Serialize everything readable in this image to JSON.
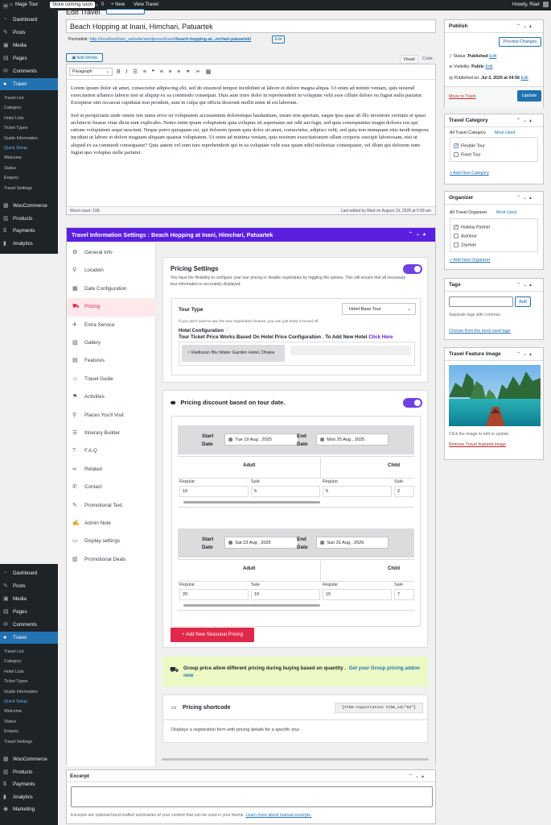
{
  "adminbar": {
    "site": "Mage Tour",
    "badge": "Store coming soon",
    "comments": "0",
    "new": "New",
    "view": "View Travel",
    "howdy": "Howdy, Riad"
  },
  "menu_top": [
    {
      "icon": "◔",
      "label": "Dashboard"
    },
    {
      "icon": "✎",
      "label": "Posts"
    },
    {
      "icon": "▣",
      "label": "Media"
    },
    {
      "icon": "▤",
      "label": "Pages"
    },
    {
      "icon": "✉",
      "label": "Comments"
    },
    {
      "icon": "●",
      "label": "Travel",
      "current": true
    }
  ],
  "submenu": [
    "Travel List",
    "Category",
    "Hotel Lists",
    "Ticket Types",
    "Guide Information",
    "Quick Setup",
    "Welcome",
    "Status",
    "Enquiry",
    "Travel Settings"
  ],
  "menu_bottom": [
    {
      "icon": "▦",
      "label": "WooCommerce"
    },
    {
      "icon": "▥",
      "label": "Products"
    },
    {
      "icon": "$",
      "label": "Payments"
    },
    {
      "icon": "▮",
      "label": "Analytics"
    }
  ],
  "menu_top2": [
    {
      "icon": "◔",
      "label": "Dashboard"
    },
    {
      "icon": "✎",
      "label": "Posts"
    },
    {
      "icon": "▣",
      "label": "Media"
    },
    {
      "icon": "▤",
      "label": "Pages"
    },
    {
      "icon": "✉",
      "label": "Comments"
    },
    {
      "icon": "●",
      "label": "Travel",
      "current": true
    }
  ],
  "menu_bottom2": [
    {
      "icon": "▦",
      "label": "WooCommerce"
    },
    {
      "icon": "▥",
      "label": "Products"
    },
    {
      "icon": "$",
      "label": "Payments"
    },
    {
      "icon": "▮",
      "label": "Analytics"
    },
    {
      "icon": "◉",
      "label": "Marketing"
    }
  ],
  "post": {
    "title": "Beach Hopping at Inani, Himchari, Patuartek",
    "permalink_label": "Permalink:",
    "permalink_url": "http://localhost/tour_website/wordpress/travel/",
    "permalink_slug": "beach-hopping-at...mchari-patuartek/",
    "edit": "Edit",
    "add_media": "Add Media",
    "tab_visual": "Visual",
    "tab_code": "Code",
    "format": "Paragraph",
    "p1": "Lorem ipsum dolor sit amet, consectetur adipiscing elit, sed do eiusmod tempor incididunt ut labore et dolore magna aliqua. Ut enim ad minim veniam, quis nostrud exercitation ullamco laboris nisi ut aliquip ex ea commodo consequat. Duis aute irure dolor in reprehenderit in voluptate velit esse cillum dolore eu fugiat nulla pariatur. Excepteur sint occaecat cupidatat non proident, sunt in culpa qui officia deserunt mollit anim id est laborum.",
    "p2": "Sed ut perspiciatis unde omnis iste natus error sit voluptatem accusantium doloremque laudantium, totam rem aperiam, eaque ipsa quae ab illo inventore veritatis et quasi architecto beatae vitae dicta sunt explicabo. Nemo enim ipsam voluptatem quia voluptas sit aspernatur aut odit aut fugit, sed quia consequuntur magni dolores eos qui ratione voluptatem sequi nesciunt. Neque porro quisquam est, qui dolorem ipsum quia dolor sit amet, consectetur, adipisci velit, sed quia non numquam eius modi tempora incidunt ut labore et dolore magnam aliquam quaerat voluptatem. Ut enim ad minima veniam, quis nostrum exercitationem ullam corporis suscipit laboriosam, nisi ut aliquid ex ea commodi consequatur? Quis autem vel eum iure reprehenderit qui in ea voluptate velit esse quam nihil molestiae consequatur, vel illum qui dolorem eum fugiat quo voluptas nulla pariatur.",
    "word_count": "Word count: 198",
    "last_edited": "Last edited by Riad on August 19, 2025 at 5:58 am"
  },
  "settings": {
    "header": "Travel Information Settings : Beach Hopping at Inani, Himchari, Patuartek",
    "tabs": [
      {
        "icon": "⚙",
        "label": "General Info"
      },
      {
        "icon": "⚲",
        "label": "Location"
      },
      {
        "icon": "▦",
        "label": "Date Configuration"
      },
      {
        "icon": "⛟",
        "label": "Pricing",
        "active": true
      },
      {
        "icon": "✈",
        "label": "Extra Service"
      },
      {
        "icon": "▧",
        "label": "Gallery"
      },
      {
        "icon": "▤",
        "label": "Features"
      },
      {
        "icon": "☺",
        "label": "Travel Guide"
      },
      {
        "icon": "⚑",
        "label": "Activities"
      },
      {
        "icon": "⚲",
        "label": "Places You'll Visit"
      },
      {
        "icon": "☰",
        "label": "Itinerary Builder"
      },
      {
        "icon": "?",
        "label": "F.A.Q"
      },
      {
        "icon": "∞",
        "label": "Related"
      },
      {
        "icon": "✆",
        "label": "Contact"
      },
      {
        "icon": "✎",
        "label": "Promotional Text"
      },
      {
        "icon": "✍",
        "label": "Admin Note"
      },
      {
        "icon": "▭",
        "label": "Display settings"
      },
      {
        "icon": "▥",
        "label": "Promotional Deals"
      }
    ]
  },
  "pricing": {
    "title": "Pricing Settings",
    "desc": "You have the flexibility to configure your tour pricing or disable registration by toggling the options. This will ensure that all necessary tour information is accurately displayed.",
    "tour_type_label": "Tour Type",
    "tour_type_value": "Hotel Base Tour",
    "tour_type_hint": "If you don't want to use the tour registration feature, you can just keep it turned off.",
    "hotel_config": "Hotel Configuration",
    "hotel_note": "Tour Ticket Price Works Based On Hotel Price Configuration . To Add New Hotel",
    "click_here": "Click Here",
    "hotel_chip": "Radisson Blu Water Garden Hotel, Dhaka"
  },
  "discount": {
    "title": "Pricing discount based on tour date.",
    "start_label": "Start Date",
    "end_label": "End Date",
    "adult": "Adult",
    "child": "Child",
    "regular": "Regular",
    "sale": "Sale",
    "seasons": [
      {
        "start": "Tue 19 Aug , 2025",
        "end": "Mon 25 Aug , 2025",
        "adult_regular": "10",
        "adult_sale": "5",
        "child_regular": "5",
        "child_sale": "2"
      },
      {
        "start": "Sat 23 Aug , 2025",
        "end": "Sun 31 Aug , 2025",
        "adult_regular": "20",
        "adult_sale": "10",
        "child_regular": "15",
        "child_sale": "7"
      }
    ],
    "add_button": "+ Add New Seasonal Pricing"
  },
  "group_notice": {
    "text": "Group price allow different pricing during buying based on quantity .",
    "link": "Get your Group pricing addon now"
  },
  "shortcode": {
    "title": "Pricing shortcode",
    "code": "[ttbm-registration ttbm_id=\"52\"]",
    "desc": "Displays a registration form with pricing details for a specific tour."
  },
  "excerpt": {
    "title": "Excerpt",
    "help": "Excerpts are optional hand-crafted summaries of your content that can be used in your theme.",
    "link": "Learn more about manual excerpts."
  },
  "publish": {
    "title": "Publish",
    "preview": "Preview Changes",
    "status_label": "Status:",
    "status": "Published",
    "visibility_label": "Visibility:",
    "visibility": "Public",
    "published_label": "Published on:",
    "published": "Jul 2, 2025 at 04:56",
    "edit": "Edit",
    "trash": "Move to Trash",
    "update": "Update"
  },
  "category": {
    "title": "Travel Category",
    "tab_all": "All Travel Category",
    "tab_most": "Most Used",
    "items": [
      {
        "label": "Flexible Tour",
        "checked": true
      },
      {
        "label": "Fixed Tour",
        "checked": false
      }
    ],
    "add": "+ Add New Category"
  },
  "organizer": {
    "title": "Organizer",
    "tab_all": "All Travel Organizer",
    "tab_most": "Most Used",
    "items": [
      {
        "label": "Holiday Partner",
        "checked": true
      },
      {
        "label": "Autotour",
        "checked": false
      },
      {
        "label": "Zayman",
        "checked": false
      }
    ],
    "add": "+ Add New Organizer"
  },
  "tags": {
    "title": "Tags",
    "add": "Add",
    "hint": "Separate tags with commas",
    "choose": "Choose from the most used tags"
  },
  "featured": {
    "title": "Travel Feature Image",
    "hint": "Click the image to edit or update",
    "remove": "Remove Travel featured image"
  },
  "colors": {
    "admin_dark": "#1d2327",
    "wp_blue": "#2271b1",
    "accent_purple": "#6c42e0",
    "pricing_red": "#e0284a"
  }
}
